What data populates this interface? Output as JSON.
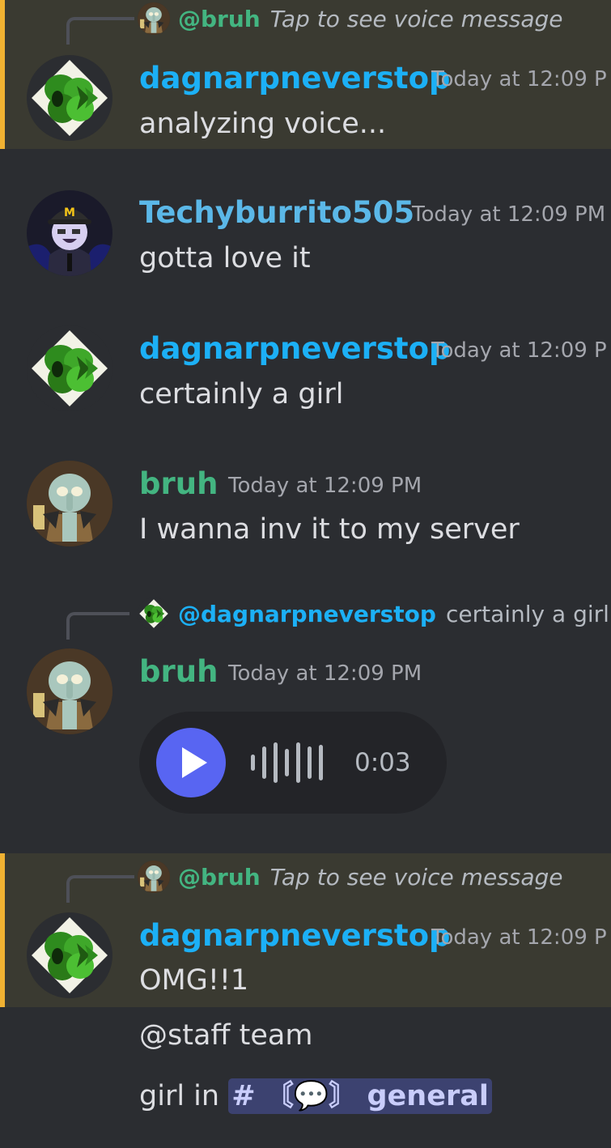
{
  "colors": {
    "background": "#2b2d31",
    "highlight_bg": "#3a3a31",
    "highlight_bar": "#f0b232",
    "username_blue": "#1cb0f6",
    "username_teal": "#5bb8e8",
    "username_green": "#43b581",
    "mention_green": "#43b581",
    "mention_blue": "#1cb0f6",
    "play_button": "#5865f2"
  },
  "messages": [
    {
      "reply": {
        "mention": "@bruh",
        "content": "Tap to see voice message",
        "avatar": "squidward-avatar-icon"
      },
      "author": "dagnarpneverstop",
      "timestamp": "Today at 12:09 P",
      "avatar": "green-clover-avatar-icon",
      "text": "analyzing voice...",
      "highlighted": true
    },
    {
      "author": "Techyburrito505",
      "timestamp": "Today at 12:09 PM",
      "avatar": "purple-character-avatar-icon",
      "text": "gotta love it"
    },
    {
      "author": "dagnarpneverstop",
      "timestamp": "Today at 12:09 P",
      "avatar": "green-clover-avatar-icon",
      "text": "certainly a girl"
    },
    {
      "author": "bruh",
      "timestamp": "Today at 12:09 PM",
      "avatar": "squidward-avatar-icon",
      "text": "I wanna inv it to my server"
    },
    {
      "reply": {
        "mention": "@dagnarpneverstop",
        "content": "certainly a girl",
        "avatar": "green-clover-avatar-icon"
      },
      "author": "bruh",
      "timestamp": "Today at 12:09 PM",
      "avatar": "squidward-avatar-icon",
      "voice": {
        "duration": "0:03",
        "icon": "play-icon"
      }
    },
    {
      "reply": {
        "mention": "@bruh",
        "content": "Tap to see voice message",
        "avatar": "squidward-avatar-icon"
      },
      "author": "dagnarpneverstop",
      "timestamp": "Today at 12:09 P",
      "avatar": "green-clover-avatar-icon",
      "text": "OMG!!1",
      "highlighted": true,
      "followups": [
        {
          "text": "@staff team"
        },
        {
          "prefix": "girl in ",
          "channel": "# 〘💬〙 general"
        }
      ]
    }
  ]
}
